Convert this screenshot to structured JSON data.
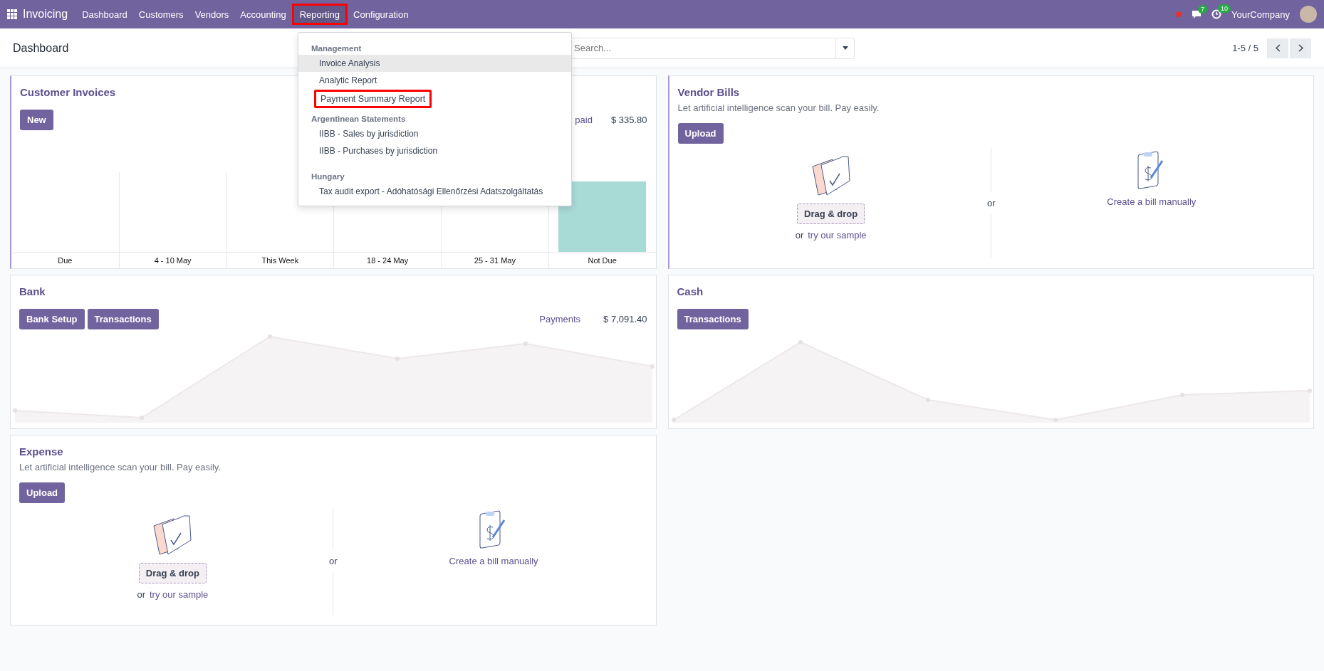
{
  "navbar": {
    "app_name": "Invoicing",
    "menu": [
      {
        "label": "Dashboard",
        "open": false,
        "highlighted": false
      },
      {
        "label": "Customers",
        "open": false,
        "highlighted": false
      },
      {
        "label": "Vendors",
        "open": false,
        "highlighted": false
      },
      {
        "label": "Accounting",
        "open": false,
        "highlighted": false
      },
      {
        "label": "Reporting",
        "open": true,
        "highlighted": true
      },
      {
        "label": "Configuration",
        "open": false,
        "highlighted": false
      }
    ],
    "messages_badge": "7",
    "activities_badge": "10",
    "company": "YourCompany"
  },
  "control_panel": {
    "breadcrumb": "Dashboard",
    "search": {
      "placeholder": "Search..."
    },
    "pager": "1-5 / 5"
  },
  "reporting_menu": [
    {
      "title": "Management",
      "items": [
        {
          "label": "Invoice Analysis",
          "hovered": true,
          "highlighted": false
        },
        {
          "label": "Analytic Report",
          "hovered": false,
          "highlighted": false
        },
        {
          "label": "Payment Summary Report",
          "hovered": false,
          "highlighted": true
        }
      ]
    },
    {
      "title": "Argentinean Statements",
      "items": [
        {
          "label": "IIBB - Sales by jurisdiction",
          "hovered": false,
          "highlighted": false
        },
        {
          "label": "IIBB - Purchases by jurisdiction",
          "hovered": false,
          "highlighted": false
        }
      ]
    },
    {
      "title": "Hungary",
      "items": [
        {
          "label": "Tax audit export - Adóhatósági Ellenőrzési Adatszolgáltatás",
          "hovered": false,
          "highlighted": false
        }
      ]
    }
  ],
  "cards": [
    {
      "kind": "invoices",
      "title": "Customer Invoices",
      "buttons": [
        "New"
      ],
      "stat_label": "paid",
      "stat_value": "$ 335.80",
      "chart_labels": [
        "Due",
        "4 - 10 May",
        "This Week",
        "18 - 24 May",
        "25 - 31 May",
        "Not Due"
      ]
    },
    {
      "kind": "upload",
      "title": "Vendor Bills",
      "subtitle": "Let artificial intelligence scan your bill. Pay easily.",
      "buttons": [
        "Upload"
      ],
      "drop": "Drag & drop",
      "or_prefix": "or",
      "sample": "try our sample",
      "middle_or": "or",
      "manual": "Create a bill manually"
    },
    {
      "kind": "journal",
      "title": "Bank",
      "buttons": [
        "Bank Setup",
        "Transactions"
      ],
      "stat_label": "Payments",
      "stat_value": "$ 7,091.40"
    },
    {
      "kind": "journal",
      "title": "Cash",
      "buttons": [
        "Transactions"
      ]
    },
    {
      "kind": "upload",
      "title": "Expense",
      "subtitle": "Let artificial intelligence scan your bill. Pay easily.",
      "buttons": [
        "Upload"
      ],
      "drop": "Drag & drop",
      "or_prefix": "or",
      "sample": "try our sample",
      "middle_or": "or",
      "manual": "Create a bill manually"
    }
  ]
}
